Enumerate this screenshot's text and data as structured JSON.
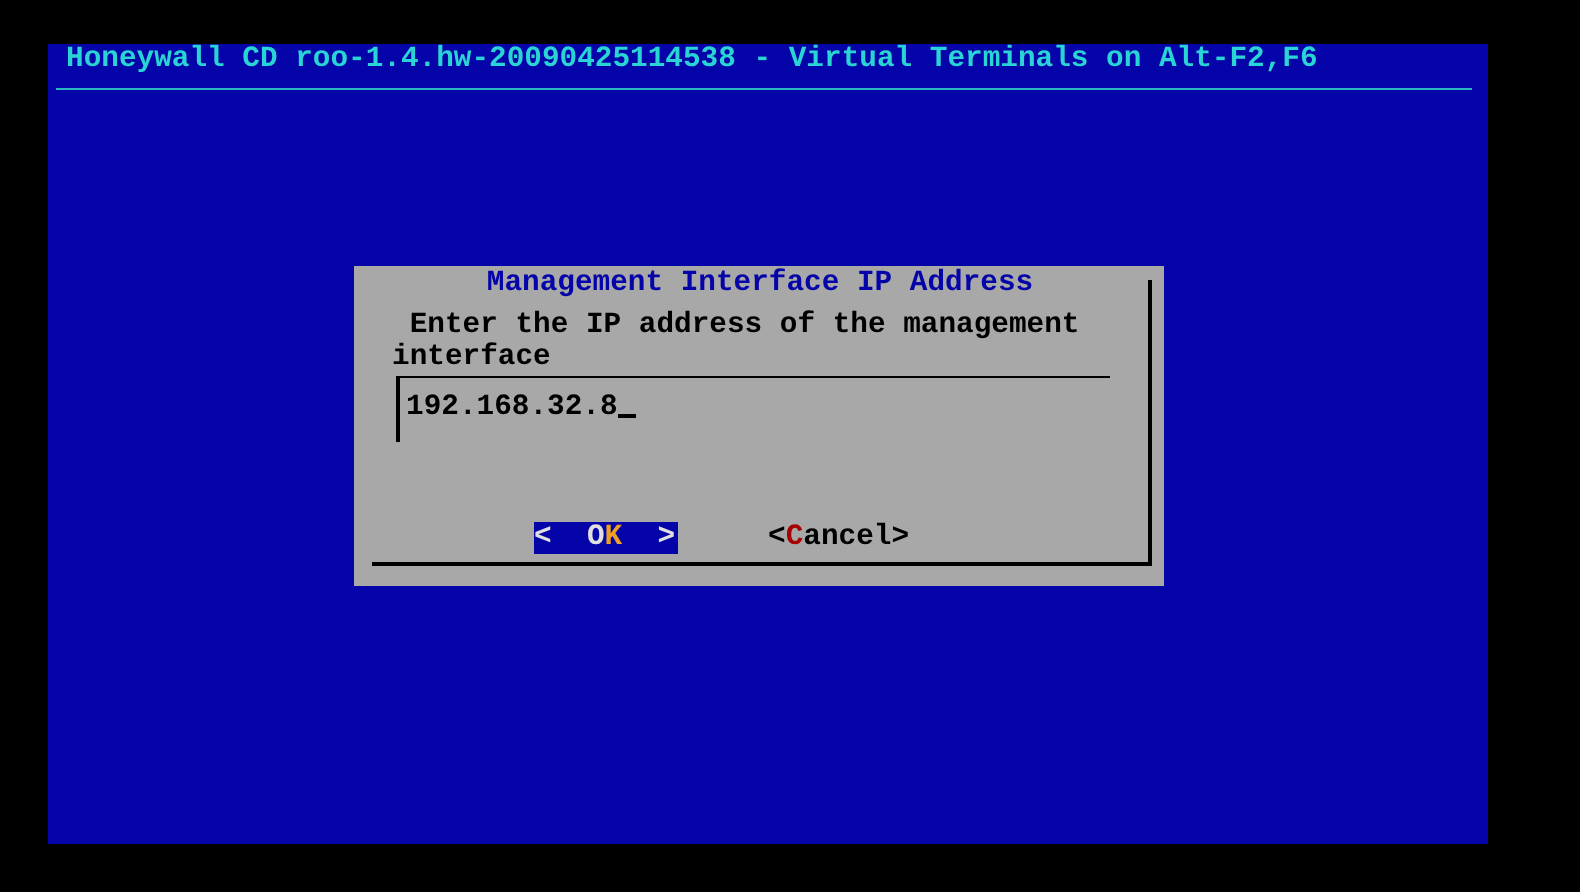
{
  "screen": {
    "title": "Honeywall CD roo-1.4.hw-20090425114538 - Virtual Terminals on Alt-F2,F6"
  },
  "dialog": {
    "title": "Management Interface IP Address",
    "prompt": "Enter the IP address of the management interface",
    "input": {
      "value": "192.168.32.8"
    },
    "buttons": [
      {
        "before": "<  O",
        "hotkey": "K",
        "after": "  >",
        "selected": true
      },
      {
        "before": "<",
        "hotkey": "C",
        "after": "ancel>",
        "selected": false
      }
    ]
  }
}
